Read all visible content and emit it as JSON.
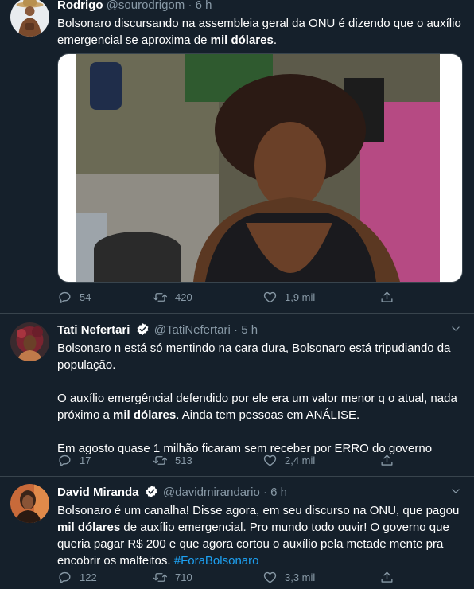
{
  "tweets": [
    {
      "name": "Rodrigo",
      "handle": "@sourodrigom",
      "time": "6 h",
      "text_parts": [
        "Bolsonaro discursando na assembleia geral da ONU é dizendo que o auxílio emergencial se aproxima de ",
        "mil dólares",
        "."
      ],
      "replies": "54",
      "retweets": "420",
      "likes": "1,9 mil"
    },
    {
      "name": "Tati Nefertari",
      "handle": "@TatiNefertari",
      "time": "5 h",
      "p1": "Bolsonaro n está só mentindo na cara dura, Bolsonaro está tripudiando da população.",
      "p2_parts": [
        "O auxílio emergêncial defendido por ele era um valor menor q o atual, nada próximo a ",
        "mil dólares",
        ". Ainda tem pessoas em ANÁLISE."
      ],
      "p3": "Em agosto quase 1 milhão ficaram sem receber por ERRO do governo",
      "replies": "17",
      "retweets": "513",
      "likes": "2,4 mil"
    },
    {
      "name": "David Miranda",
      "handle": "@davidmirandario",
      "time": "6 h",
      "text_parts": [
        "Bolsonaro é um canalha! Disse agora, em seu discurso na ONU, que pagou ",
        "mil dólares",
        " de auxílio emergencial. Pro mundo todo ouvir! O governo que queria pagar R$ 200 e que agora cortou o auxílio pela metade mente pra encobrir os malfeitos. "
      ],
      "hashtag": "#ForaBolsonaro",
      "replies": "122",
      "retweets": "710",
      "likes": "3,3 mil"
    }
  ],
  "separator": "·",
  "colors": {
    "background": "#15202b",
    "secondary": "#8899a6",
    "accent": "#1da1f2",
    "divider": "#38444d"
  },
  "icons": [
    "reply-icon",
    "retweet-icon",
    "like-icon",
    "share-icon",
    "verified-icon",
    "chevron-down-icon"
  ]
}
